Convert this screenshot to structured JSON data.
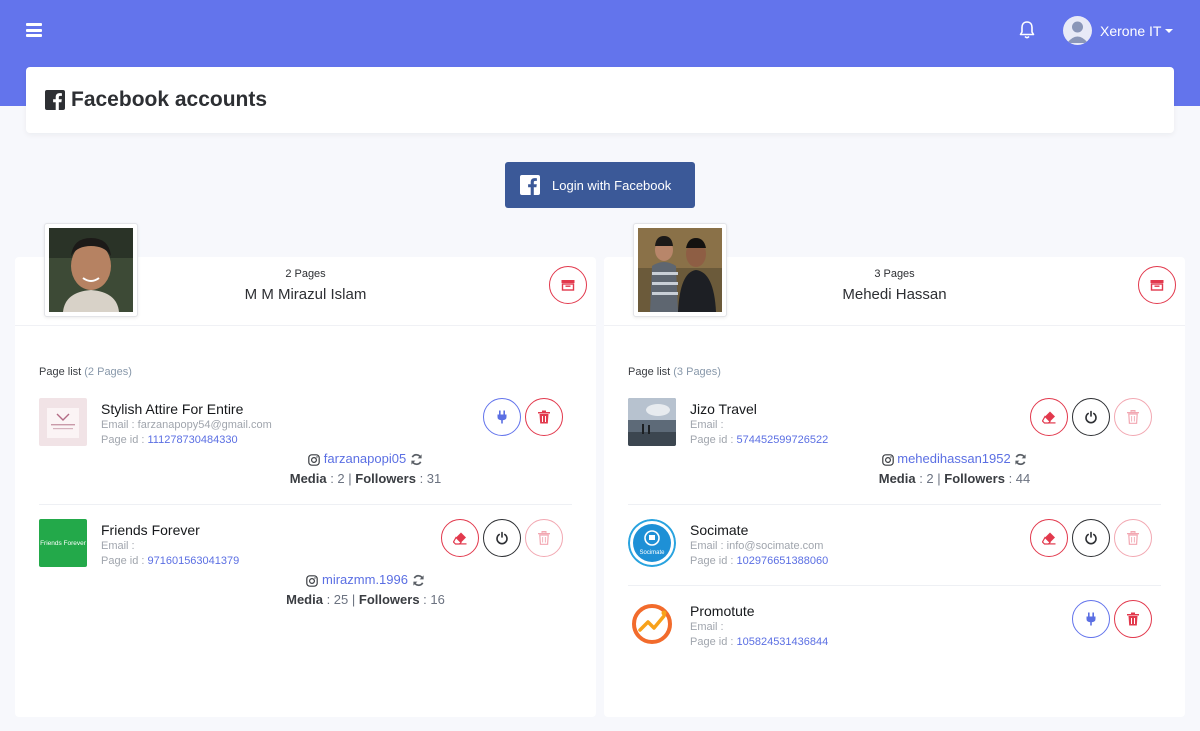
{
  "topbar": {
    "user_name": "Xerone IT",
    "icons": {
      "menu": "hamburger-icon",
      "notifications": "bell-icon",
      "avatar": "user-avatar-icon",
      "dropdown": "caret-down-icon"
    }
  },
  "header": {
    "title": "Facebook accounts",
    "icon": "facebook-square-icon"
  },
  "login_button": {
    "label": "Login with Facebook",
    "icon": "facebook-f-icon"
  },
  "colors": {
    "accent": "#6374ec",
    "facebook": "#3b5998",
    "danger": "#e2394d",
    "link": "#5b6fe3"
  },
  "accounts": [
    {
      "pages_count": "2 Pages",
      "name": "M M Mirazul Islam",
      "page_list_label": "Page list",
      "page_list_count": "(2 Pages)",
      "pages": [
        {
          "name": "Stylish Attire For Entire",
          "email": "Email : farzanapopy54@gmail.com",
          "page_id_label": "Page id :",
          "page_id": "111278730484330",
          "instagram": "farzanapopi05",
          "media_label": "Media",
          "media": "2",
          "followers_label": "Followers",
          "followers": "31"
        },
        {
          "name": "Friends Forever",
          "thumb_text": "Friends Forever",
          "email": "Email :",
          "page_id_label": "Page id :",
          "page_id": "971601563041379",
          "instagram": "mirazmm.1996",
          "media_label": "Media",
          "media": "25",
          "followers_label": "Followers",
          "followers": "16"
        }
      ]
    },
    {
      "pages_count": "3 Pages",
      "name": "Mehedi Hassan",
      "page_list_label": "Page list",
      "page_list_count": "(3 Pages)",
      "pages": [
        {
          "name": "Jizo Travel",
          "email": "Email :",
          "page_id_label": "Page id :",
          "page_id": "574452599726522",
          "instagram": "mehedihassan1952",
          "media_label": "Media",
          "media": "2",
          "followers_label": "Followers",
          "followers": "44"
        },
        {
          "name": "Socimate",
          "thumb_text": "Socimate",
          "email": "Email : info@socimate.com",
          "page_id_label": "Page id :",
          "page_id": "102976651388060"
        },
        {
          "name": "Promotute",
          "email": "Email :",
          "page_id_label": "Page id :",
          "page_id": "105824531436844"
        }
      ]
    }
  ]
}
